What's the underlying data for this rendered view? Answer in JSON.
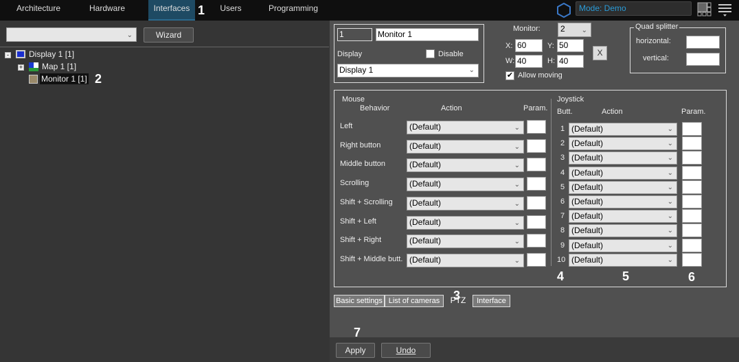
{
  "nav": {
    "tabs": [
      "Architecture",
      "Hardware",
      "Interfaces",
      "Users",
      "Programming"
    ],
    "active": "Interfaces",
    "mode": "Mode: Demo"
  },
  "left": {
    "object_select": "",
    "wizard": "Wizard",
    "tree": [
      {
        "label": "Display 1 [1]",
        "expanded": true
      },
      {
        "label": "Map 1 [1]",
        "expanded": false
      },
      {
        "label": "Monitor 1 [1]",
        "selected": true
      }
    ]
  },
  "monitor": {
    "id": "1",
    "name": "Monitor 1",
    "display_label": "Display",
    "disable_label": "Disable",
    "disable_checked": false,
    "display_value": "Display 1",
    "monitor_label": "Monitor:",
    "monitor_value": "2",
    "x_label": "X:",
    "x": "60",
    "y_label": "Y:",
    "y": "50",
    "w_label": "W:",
    "w": "40",
    "h_label": "H:",
    "h": "40",
    "x_button": "X",
    "allow_moving": "Allow moving",
    "allow_moving_checked": true
  },
  "quad": {
    "title": "Quad splitter",
    "horizontal": "horizontal:",
    "vertical": "vertical:",
    "horizontal_value": "",
    "vertical_value": ""
  },
  "mouse": {
    "title": "Mouse",
    "col_behavior": "Behavior",
    "col_action": "Action",
    "col_param": "Param.",
    "rows": [
      {
        "behavior": "Left",
        "action": "(Default)"
      },
      {
        "behavior": "Right button",
        "action": "(Default)"
      },
      {
        "behavior": "Middle button",
        "action": "(Default)"
      },
      {
        "behavior": "Scrolling",
        "action": "(Default)"
      },
      {
        "behavior": "Shift + Scrolling",
        "action": "(Default)"
      },
      {
        "behavior": "Shift + Left",
        "action": "(Default)"
      },
      {
        "behavior": "Shift + Right",
        "action": "(Default)"
      },
      {
        "behavior": "Shift + Middle butt.",
        "action": "(Default)"
      }
    ]
  },
  "joystick": {
    "title": "Joystick",
    "col_button": "Butt.",
    "col_action": "Action",
    "col_param": "Param.",
    "rows": [
      {
        "button": "1",
        "action": "(Default)"
      },
      {
        "button": "2",
        "action": "(Default)"
      },
      {
        "button": "3",
        "action": "(Default)"
      },
      {
        "button": "4",
        "action": "(Default)"
      },
      {
        "button": "5",
        "action": "(Default)"
      },
      {
        "button": "6",
        "action": "(Default)"
      },
      {
        "button": "7",
        "action": "(Default)"
      },
      {
        "button": "8",
        "action": "(Default)"
      },
      {
        "button": "9",
        "action": "(Default)"
      },
      {
        "button": "10",
        "action": "(Default)"
      }
    ]
  },
  "tabs": [
    "Basic settings",
    "List of cameras",
    "PTZ",
    "Interface"
  ],
  "active_tab": "PTZ",
  "footer": {
    "apply": "Apply",
    "undo": "Undo"
  },
  "annotations": [
    "1",
    "2",
    "3",
    "4",
    "5",
    "6",
    "7"
  ]
}
